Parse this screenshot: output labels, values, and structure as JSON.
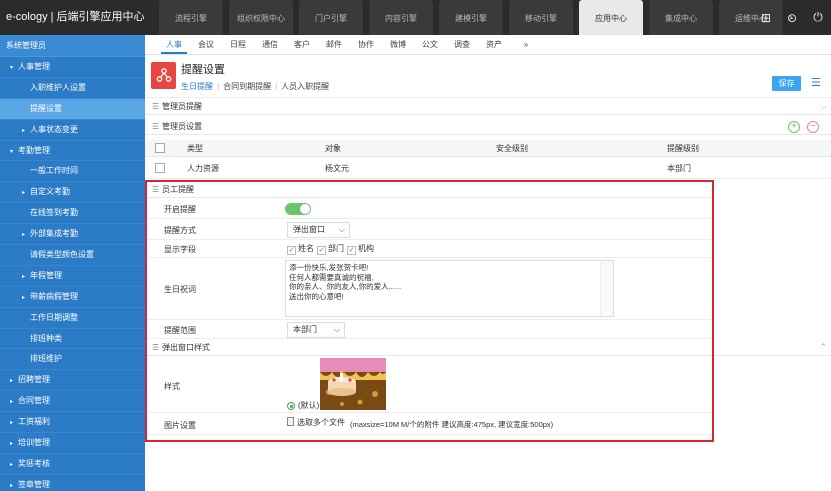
{
  "app": {
    "brand": "e-cology | 后端引擎应用中心"
  },
  "topnav": {
    "tabs": [
      {
        "label": "流程引擎"
      },
      {
        "label": "组织权限中心"
      },
      {
        "label": "门户引擎"
      },
      {
        "label": "内容引擎"
      },
      {
        "label": "建模引擎"
      },
      {
        "label": "移动引擎"
      },
      {
        "label": "应用中心",
        "active": true
      },
      {
        "label": "集成中心"
      },
      {
        "label": "运维中心"
      }
    ],
    "more_icon": "chevron-right-icon",
    "icons": [
      "grid-icon",
      "more-icon",
      "power-icon"
    ]
  },
  "sidebar": {
    "title": "系统管理员",
    "items": [
      {
        "label": "人事管理",
        "level": 1,
        "caret": "▾"
      },
      {
        "label": "入职维护人设置",
        "level": 2
      },
      {
        "label": "提醒设置",
        "level": 2,
        "active": true
      },
      {
        "label": "人事状态变更",
        "level": 2,
        "caret": "▸"
      },
      {
        "label": "考勤管理",
        "level": 1,
        "caret": "▾"
      },
      {
        "label": "一般工作时间",
        "level": 2
      },
      {
        "label": "自定义考勤",
        "level": 2,
        "caret": "▸"
      },
      {
        "label": "在线签到考勤",
        "level": 2
      },
      {
        "label": "外部集成考勤",
        "level": 2,
        "caret": "▸"
      },
      {
        "label": "请假类型颜色设置",
        "level": 2
      },
      {
        "label": "年假管理",
        "level": 2,
        "caret": "▸"
      },
      {
        "label": "带薪病假管理",
        "level": 2,
        "caret": "▸"
      },
      {
        "label": "工作日期调整",
        "level": 2
      },
      {
        "label": "排班种类",
        "level": 2
      },
      {
        "label": "排班维护",
        "level": 2
      },
      {
        "label": "招聘管理",
        "level": 1,
        "caret": "▸"
      },
      {
        "label": "合同管理",
        "level": 1,
        "caret": "▸"
      },
      {
        "label": "工资福利",
        "level": 1,
        "caret": "▸"
      },
      {
        "label": "培训管理",
        "level": 1,
        "caret": "▸"
      },
      {
        "label": "奖惩考核",
        "level": 1,
        "caret": "▸"
      },
      {
        "label": "签章管理",
        "level": 1,
        "caret": "▸"
      }
    ]
  },
  "subnav": {
    "tabs": [
      {
        "label": "人事",
        "active": true
      },
      {
        "label": "会议"
      },
      {
        "label": "日程"
      },
      {
        "label": "通信"
      },
      {
        "label": "客户"
      },
      {
        "label": "邮件"
      },
      {
        "label": "协作"
      },
      {
        "label": "微博"
      },
      {
        "label": "公文"
      },
      {
        "label": "调查"
      },
      {
        "label": "资产"
      }
    ],
    "more": "»"
  },
  "header": {
    "title": "提醒设置",
    "tabs": [
      {
        "label": "生日提醒",
        "active": true
      },
      {
        "label": "合同到期提醒"
      },
      {
        "label": "人员入职提醒"
      }
    ],
    "save_label": "保存"
  },
  "sections": {
    "admin_reminder": "管理员提醒",
    "admin_settings": "管理员设置",
    "employee_reminder": "员工提醒",
    "popup_style": "弹出窗口样式"
  },
  "admin_table": {
    "columns": [
      "类型",
      "对象",
      "安全级别",
      "提醒级别"
    ],
    "rows": [
      {
        "type": "人力资源",
        "object": "杨文元",
        "security": "",
        "level": "本部门"
      }
    ]
  },
  "employee_form": {
    "enable_label": "开启提醒",
    "enable_value": true,
    "method_label": "提醒方式",
    "method_value": "弹出窗口",
    "fields_label": "显示字段",
    "fields": [
      {
        "label": "姓名",
        "checked": false,
        "disabled": true
      },
      {
        "label": "部门",
        "checked": true
      },
      {
        "label": "机构",
        "checked": true
      }
    ],
    "greeting_label": "生日祝词",
    "greeting_text": "添一份快乐,发张贺卡吧!\n任何人都需要真诚的祝福,\n你的亲人、你的友人,你的爱人......\n送出你的心意吧!",
    "scope_label": "提醒范围",
    "scope_value": "本部门",
    "style_label": "样式",
    "style_option": "(默认)",
    "image_label": "图片设置",
    "image_button": "选取多个文件",
    "image_hint": "(maxsize=10M M/个的附件 建议高度:475px, 建议宽度:500px)"
  }
}
